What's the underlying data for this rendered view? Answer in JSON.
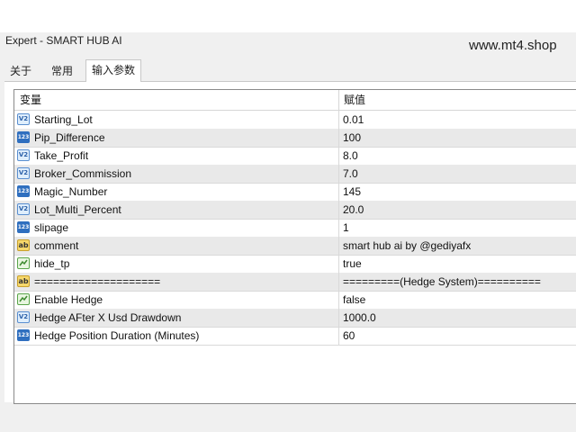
{
  "window": {
    "title": "Expert - SMART HUB AI"
  },
  "watermark": "www.mt4.shop",
  "tabs": [
    {
      "label": "关于"
    },
    {
      "label": "常用"
    },
    {
      "label": "输入参数",
      "active": true
    }
  ],
  "table": {
    "headers": {
      "name": "变量",
      "value": "赋值"
    },
    "rows": [
      {
        "icon": "double-type-icon",
        "name": "Starting_Lot",
        "value": "0.01"
      },
      {
        "icon": "int-type-icon",
        "name": "Pip_Difference",
        "value": "100"
      },
      {
        "icon": "double-type-icon",
        "name": "Take_Profit",
        "value": "8.0"
      },
      {
        "icon": "double-type-icon",
        "name": "Broker_Commission",
        "value": "7.0"
      },
      {
        "icon": "int-type-icon",
        "name": "Magic_Number",
        "value": "145"
      },
      {
        "icon": "double-type-icon",
        "name": "Lot_Multi_Percent",
        "value": "20.0"
      },
      {
        "icon": "int-type-icon",
        "name": "slipage",
        "value": "1"
      },
      {
        "icon": "string-type-icon",
        "name": "comment",
        "value": "smart hub ai by @gediyafx"
      },
      {
        "icon": "bool-type-icon",
        "name": "hide_tp",
        "value": "true"
      },
      {
        "icon": "string-type-icon",
        "name": "====================",
        "value": "=========(Hedge System)=========="
      },
      {
        "icon": "bool-type-icon",
        "name": "Enable Hedge",
        "value": "false"
      },
      {
        "icon": "double-type-icon",
        "name": "Hedge AFter X Usd Drawdown",
        "value": "1000.0"
      },
      {
        "icon": "int-type-icon",
        "name": "Hedge Position Duration (Minutes)",
        "value": "60"
      }
    ]
  },
  "icon_labels": {
    "double": "V2",
    "int": "123",
    "string": "ab"
  },
  "colors": {
    "row_alt": "#e9e9e9",
    "grid_border": "#8a8a8a",
    "tab_active_bg": "#ffffff"
  }
}
